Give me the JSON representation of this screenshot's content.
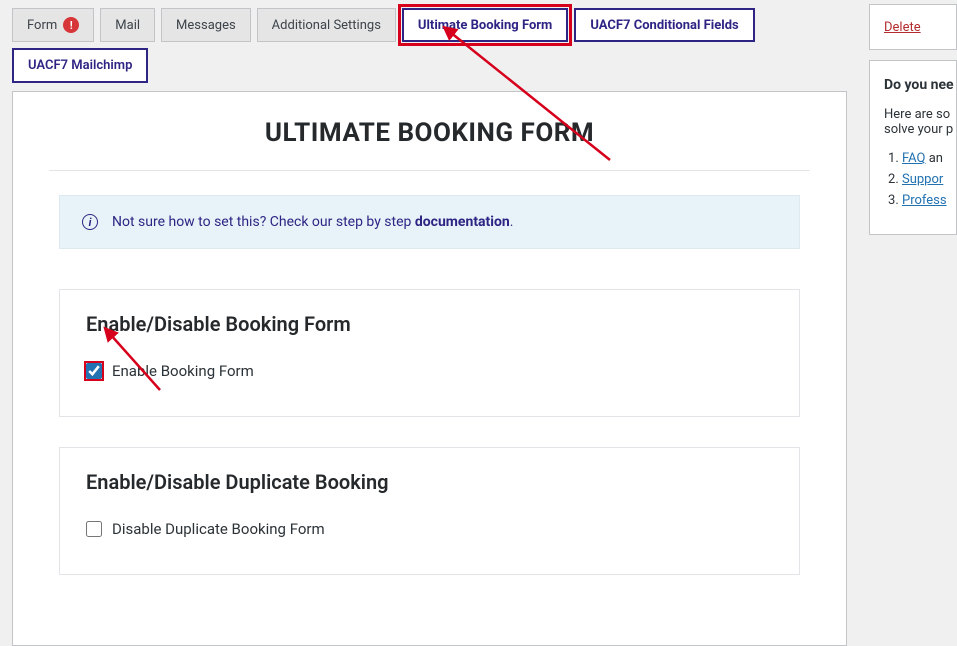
{
  "tabs": {
    "form": "Form",
    "mail": "Mail",
    "messages": "Messages",
    "additional": "Additional Settings",
    "ultimate": "Ultimate Booking Form",
    "conditional": "UACF7 Conditional Fields",
    "mailchimp": "UACF7 Mailchimp"
  },
  "page_title": "ULTIMATE BOOKING FORM",
  "notice": {
    "prefix": "Not sure how to set this? Check our step by step ",
    "link": "documentation",
    "suffix": "."
  },
  "section1": {
    "heading": "Enable/Disable Booking Form",
    "checkbox_label": "Enable Booking Form",
    "checked": true
  },
  "section2": {
    "heading": "Enable/Disable Duplicate Booking",
    "checkbox_label": "Disable Duplicate Booking Form",
    "checked": false
  },
  "sidebar": {
    "delete": "Delete",
    "help_title": "Do you nee",
    "help_text_1": "Here are so",
    "help_text_2": "solve your p",
    "links": {
      "faq": "FAQ",
      "faq_suffix": " an",
      "support": "Suppor",
      "pro": "Profess"
    }
  }
}
